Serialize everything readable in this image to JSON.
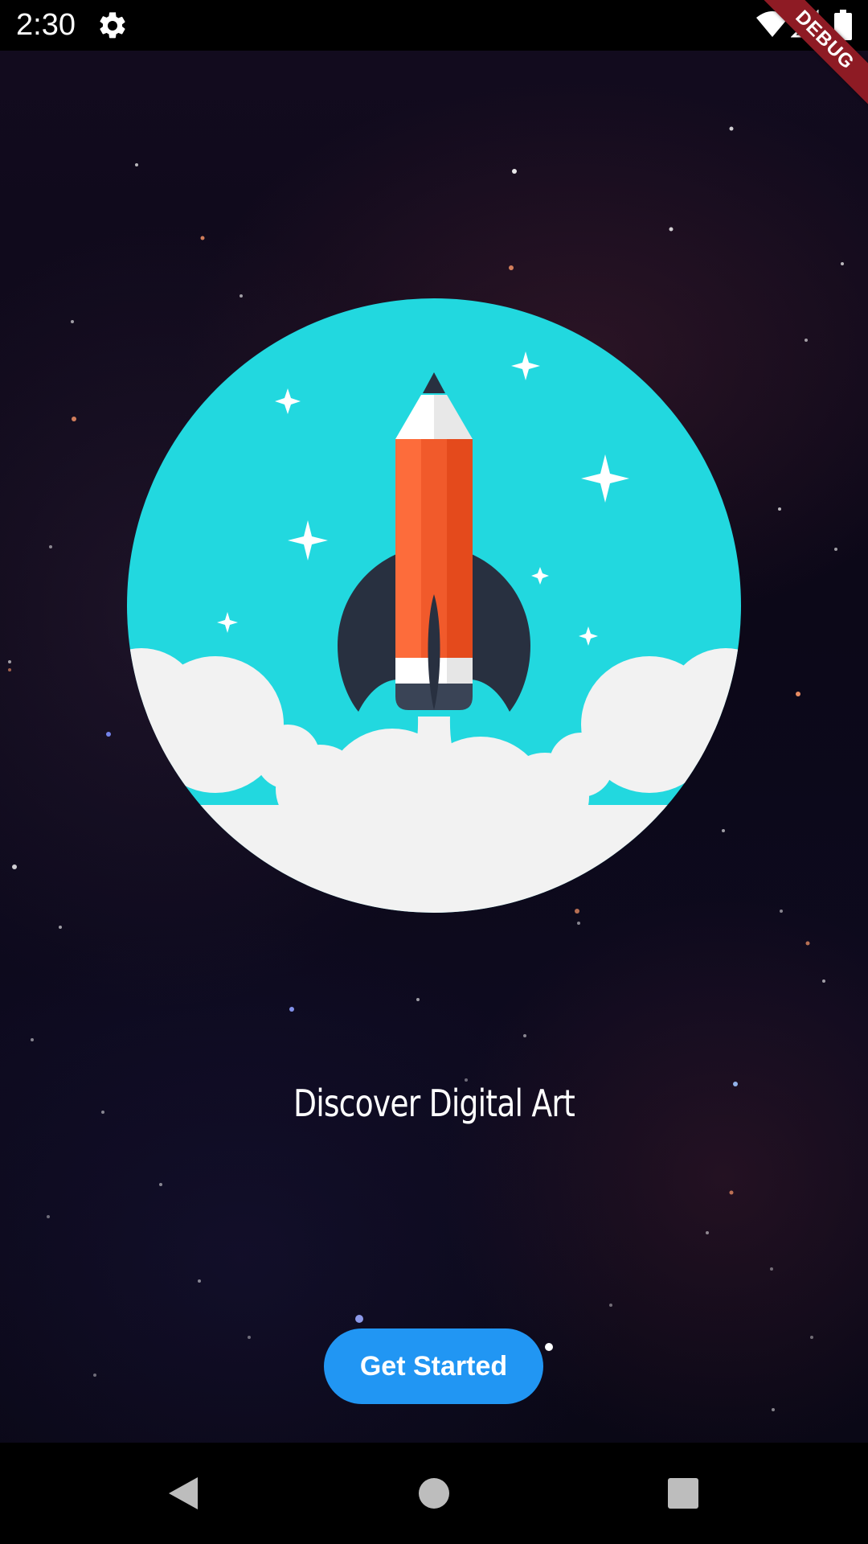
{
  "status_bar": {
    "time": "2:30",
    "icons": [
      "gear-icon",
      "wifi-icon",
      "cell-signal-icon",
      "battery-icon"
    ]
  },
  "debug_banner": {
    "label": "DEBUG",
    "color": "#8e1b24"
  },
  "hero": {
    "illustration": "pencil-rocket-illustration",
    "circle_color": "#22d8df",
    "pencil_color": "#f15a2b",
    "cloud_color": "#f2f2f2"
  },
  "headline": "Discover Digital Art",
  "cta": {
    "label": "Get Started",
    "color": "#2196f3"
  },
  "nav_bar": {
    "icons": [
      "back-icon",
      "home-icon",
      "recents-icon"
    ]
  }
}
